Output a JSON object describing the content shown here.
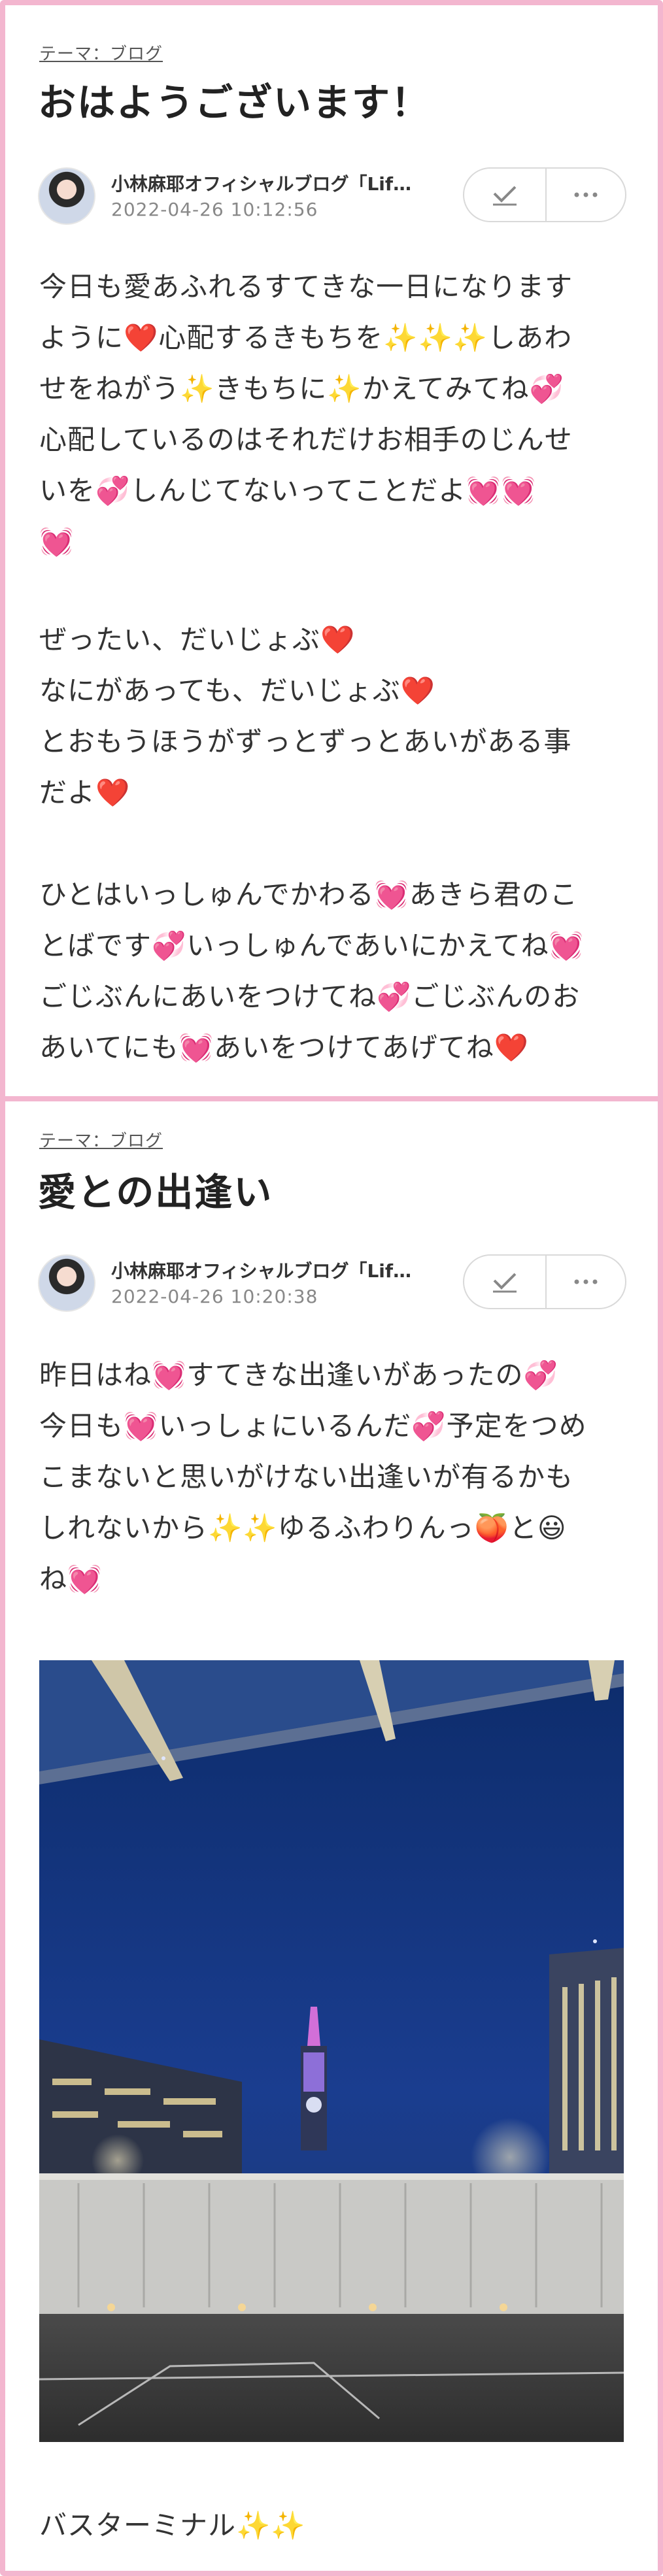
{
  "posts": [
    {
      "theme": "テーマ：ブログ",
      "title": "おはようございます！",
      "author": "小林麻耶オフィシャルブログ「Lif…",
      "date": "2022-04-26 10:12:56",
      "paragraphs": [
        [
          "今日も愛あふれるすてきな一日になります",
          "ように❤️心配するきもちを✨✨✨しあわ",
          "せをねがう✨きもちに✨かえてみてね💞",
          "心配しているのはそれだけお相手のじんせ",
          "いを💞しんじてないってことだよ💓💓",
          "💓"
        ],
        [
          "ぜったい、だいじょぶ❤️",
          "なにがあっても、だいじょぶ❤️",
          "とおもうほうがずっとずっとあいがある事",
          "だよ❤️"
        ],
        [
          "ひとはいっしゅんでかわる💓あきら君のこ",
          "とばです💞いっしゅんであいにかえてね💓",
          "ごじぶんにあいをつけてね💞ごじぶんのお",
          "あいてにも💓あいをつけてあげてね❤️"
        ]
      ]
    },
    {
      "theme": "テーマ：ブログ",
      "title": "愛との出逢い",
      "author": "小林麻耶オフィシャルブログ「Lif…",
      "date": "2022-04-26 10:20:38",
      "paragraphs": [
        [
          "昨日はね💓すてきな出逢いがあったの💞",
          "今日も💓いっしょにいるんだ💞予定をつめ",
          "こまないと思いがけない出逢いが有るかも",
          "しれないから✨✨ゆるふわりんっ🍑と😃",
          "ね💓"
        ]
      ],
      "caption": "バスターミナル✨✨"
    }
  ]
}
